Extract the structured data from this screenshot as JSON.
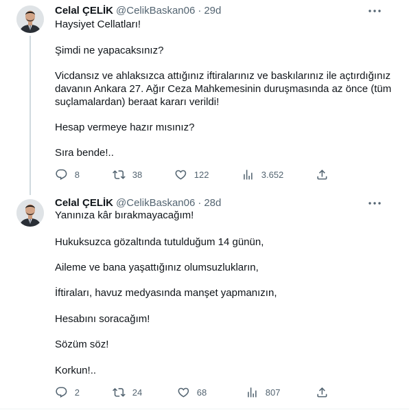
{
  "tweets": [
    {
      "author_name": "Celal ÇELİK",
      "handle": "@CelikBaskan06",
      "separator": "·",
      "time": "29d",
      "lines": [
        "Haysiyet Cellatları!",
        "Şimdi ne yapacaksınız?",
        "Vicdansız ve ahlaksızca attığınız iftiralarınız ve baskılarınız ile açtırdığınız",
        "davanın Ankara 27. Ağır Ceza Mahkemesinin duruşmasında az önce (tüm",
        "suçlamalardan) beraat kararı verildi!",
        "Hesap vermeye hazır mısınız?",
        "Sıra bende!.."
      ],
      "replies": "8",
      "reposts": "38",
      "likes": "122",
      "views": "3.652"
    },
    {
      "author_name": "Celal ÇELİK",
      "handle": "@CelikBaskan06",
      "separator": "·",
      "time": "28d",
      "lines": [
        "Yanınıza kâr bırakmayacağım!",
        "Hukuksuzca gözaltında tutulduğum 14 günün,",
        "Aileme ve bana yaşattığınız olumsuzlukların,",
        "İftiraları, havuz medyasında manşet yapmanızın,",
        "Hesabını soracağım!",
        "Sözüm söz!",
        "Korkun!.."
      ],
      "replies": "2",
      "reposts": "24",
      "likes": "68",
      "views": "807"
    }
  ]
}
